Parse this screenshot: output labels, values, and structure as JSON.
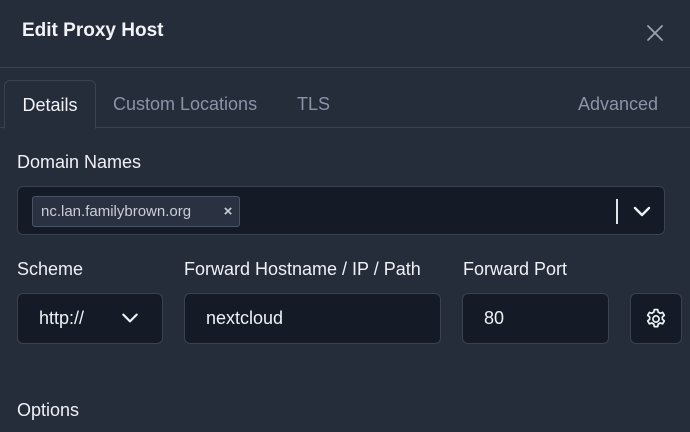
{
  "dialog": {
    "title": "Edit Proxy Host",
    "close_icon": "close-icon"
  },
  "tabs": [
    {
      "label": "Details",
      "active": true
    },
    {
      "label": "Custom Locations",
      "active": false
    },
    {
      "label": "TLS",
      "active": false
    },
    {
      "label": "Advanced",
      "active": false
    }
  ],
  "domain_names": {
    "label": "Domain Names",
    "chips": [
      {
        "value": "nc.lan.familybrown.org",
        "remove_symbol": "×"
      }
    ]
  },
  "scheme": {
    "label": "Scheme",
    "value": "http://"
  },
  "forward_hostname": {
    "label": "Forward Hostname / IP / Path",
    "value": "nextcloud"
  },
  "forward_port": {
    "label": "Forward Port",
    "value": "80"
  },
  "options": {
    "label": "Options"
  },
  "colors": {
    "background": "#252c3a",
    "input_background": "#141a26",
    "border": "#3a4252",
    "text": "#eef1f6",
    "muted_text": "#8b94a7"
  }
}
